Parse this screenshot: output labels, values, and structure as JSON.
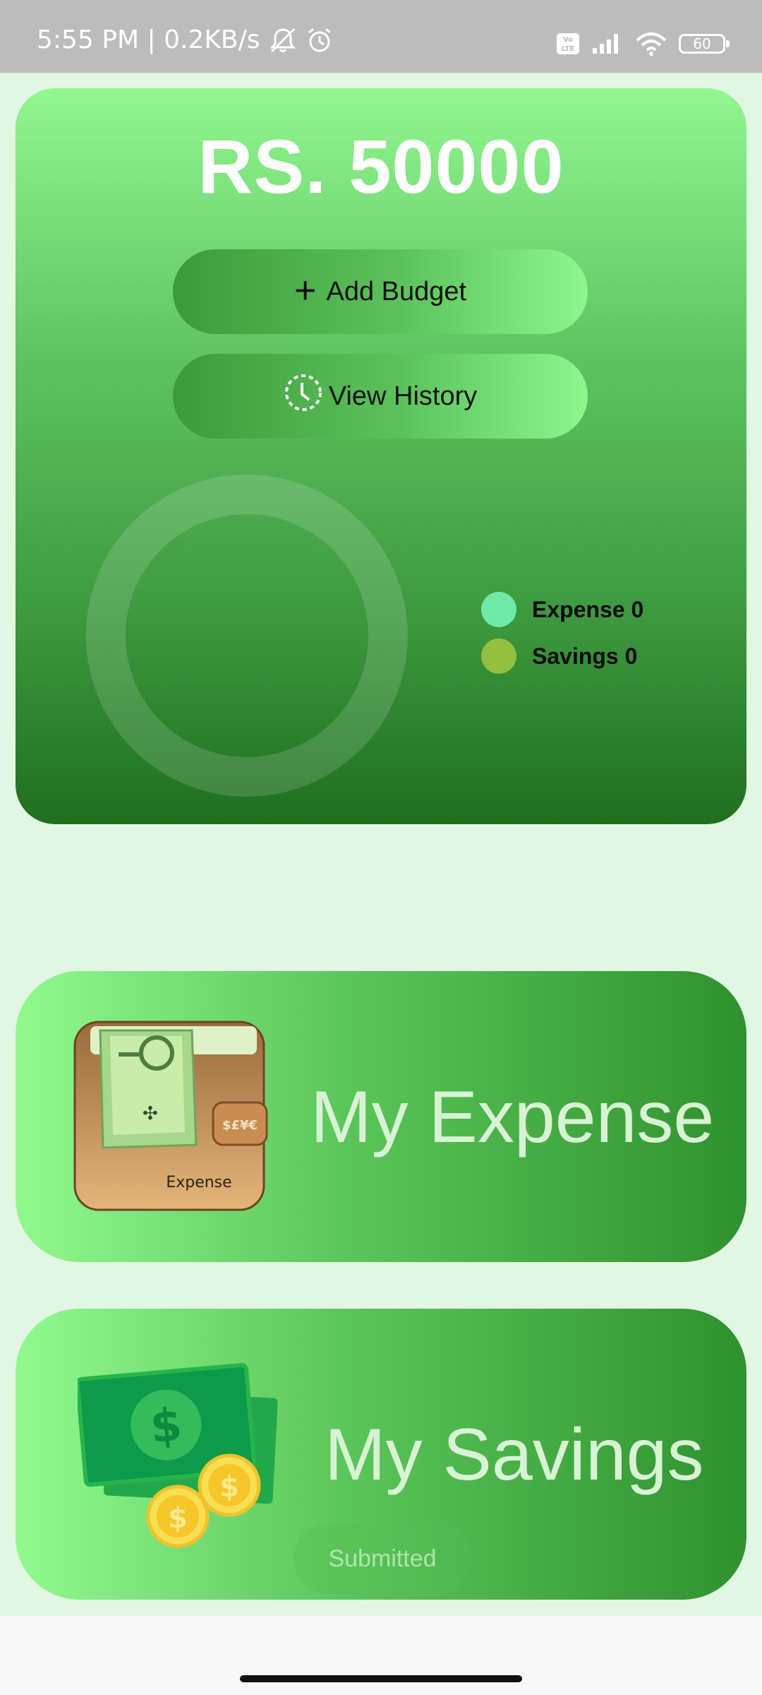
{
  "status_bar": {
    "time_speed": "5:55 PM | 0.2KB/s",
    "volte_label": "Vo LTE",
    "battery": "60"
  },
  "budget": {
    "amount": "RS. 50000",
    "add_button_label": "Add Budget",
    "history_button_label": "View History"
  },
  "legend": {
    "expense_label": "Expense 0",
    "savings_label": "Savings 0"
  },
  "colors": {
    "expense": "#6fe8a8",
    "savings": "#95bf3f"
  },
  "cards": {
    "expense_label": "My Expense",
    "expense_icon_text": "Expense",
    "expense_clasp_text": "$£¥€",
    "savings_label": "My Savings"
  },
  "toast": {
    "message": "Submitted"
  }
}
